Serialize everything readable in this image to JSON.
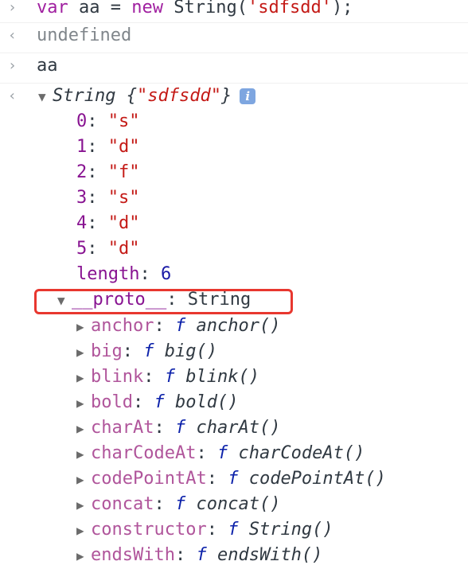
{
  "console": {
    "input1": {
      "kw_var": "var",
      "name": "aa",
      "op": "=",
      "kw_new": "new",
      "callee": "String(",
      "arg": "'sdfsdd'",
      "end": ");"
    },
    "output1": "undefined",
    "input2": "aa",
    "output2": {
      "type": "String",
      "open": " {",
      "value": "\"sdfsdd\"",
      "close": "}"
    },
    "info_glyph": "i",
    "indices": [
      {
        "key": "0",
        "value": "\"s\""
      },
      {
        "key": "1",
        "value": "\"d\""
      },
      {
        "key": "2",
        "value": "\"f\""
      },
      {
        "key": "3",
        "value": "\"s\""
      },
      {
        "key": "4",
        "value": "\"d\""
      },
      {
        "key": "5",
        "value": "\"d\""
      }
    ],
    "length": {
      "key": "length",
      "value": "6"
    },
    "proto": {
      "key": "__proto__",
      "value": "String"
    },
    "methods": [
      {
        "key": "anchor",
        "value": "anchor()"
      },
      {
        "key": "big",
        "value": "big()"
      },
      {
        "key": "blink",
        "value": "blink()"
      },
      {
        "key": "bold",
        "value": "bold()"
      },
      {
        "key": "charAt",
        "value": "charAt()"
      },
      {
        "key": "charCodeAt",
        "value": "charCodeAt()"
      },
      {
        "key": "codePointAt",
        "value": "codePointAt()"
      },
      {
        "key": "concat",
        "value": "concat()"
      },
      {
        "key": "constructor",
        "value": "String()"
      },
      {
        "key": "endsWith",
        "value": "endsWith()"
      }
    ],
    "fn_marker": "f",
    "prompt_glyph": "›",
    "result_glyph": "‹",
    "expand_glyph": "▼",
    "collapse_glyph": "▶",
    "colon": ":"
  }
}
